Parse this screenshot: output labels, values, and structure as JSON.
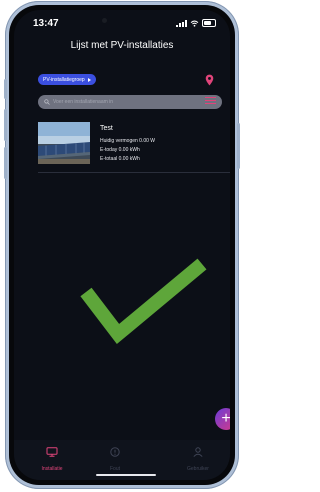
{
  "status": {
    "time": "13:47"
  },
  "header": {
    "title": "Lijst met PV-installaties"
  },
  "filters": {
    "group_chip_label": "PV-installatiegroep",
    "search_placeholder": "Voer een installatienaam in"
  },
  "installations": [
    {
      "name": "Test",
      "current_power": "Huidig vermogen 0.00 W",
      "daily_yield": "E-today 0.00 kWh",
      "total_yield": "E-totaal 0.00 kWh"
    }
  ],
  "tabs": [
    {
      "label": "Installatie",
      "active": true
    },
    {
      "label": "Fout",
      "active": false
    },
    {
      "label": "Gebruiker",
      "active": false
    }
  ],
  "colors": {
    "accent": "#e0447a",
    "chip": "#3b4fe0",
    "check": "#5ea63a",
    "background": "#0c0f17"
  }
}
